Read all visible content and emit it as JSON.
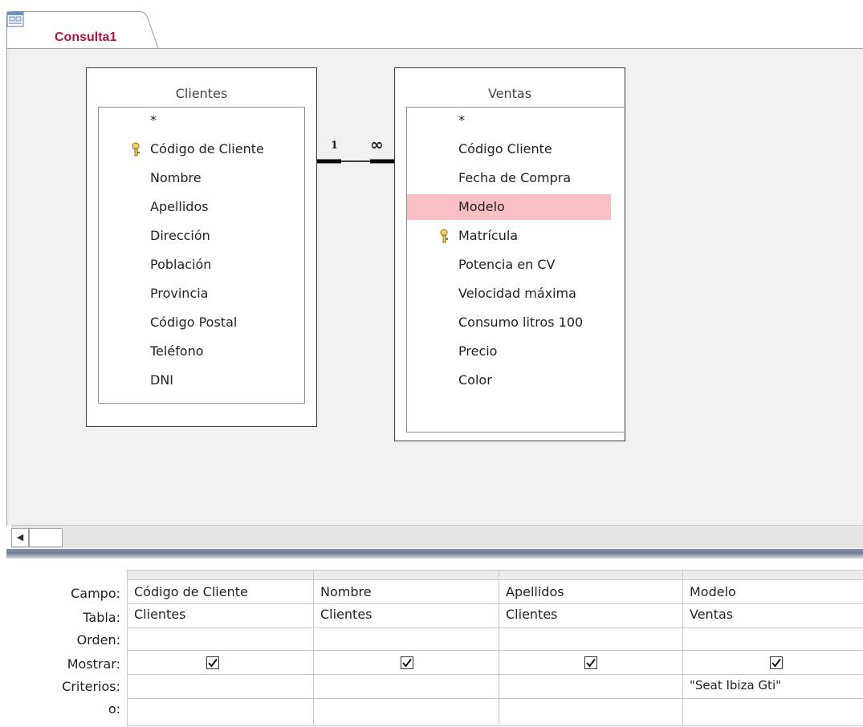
{
  "tab": {
    "label": "Consulta1",
    "icon": "query-design-icon"
  },
  "relationship": {
    "one_label": "1",
    "many_label": "∞"
  },
  "tables": [
    {
      "title": "Clientes",
      "fields": [
        {
          "name": "*",
          "key": false,
          "selected": false
        },
        {
          "name": "Código de Cliente",
          "key": true,
          "selected": false
        },
        {
          "name": "Nombre",
          "key": false,
          "selected": false
        },
        {
          "name": "Apellidos",
          "key": false,
          "selected": false
        },
        {
          "name": "Dirección",
          "key": false,
          "selected": false
        },
        {
          "name": "Población",
          "key": false,
          "selected": false
        },
        {
          "name": "Provincia",
          "key": false,
          "selected": false
        },
        {
          "name": "Código Postal",
          "key": false,
          "selected": false
        },
        {
          "name": "Teléfono",
          "key": false,
          "selected": false
        },
        {
          "name": "DNI",
          "key": false,
          "selected": false
        }
      ]
    },
    {
      "title": "Ventas",
      "fields": [
        {
          "name": "*",
          "key": false,
          "selected": false
        },
        {
          "name": "Código Cliente",
          "key": false,
          "selected": false
        },
        {
          "name": "Fecha de Compra",
          "key": false,
          "selected": false
        },
        {
          "name": "Modelo",
          "key": false,
          "selected": true
        },
        {
          "name": "Matrícula",
          "key": true,
          "selected": false
        },
        {
          "name": "Potencia en CV",
          "key": false,
          "selected": false
        },
        {
          "name": "Velocidad máxima",
          "key": false,
          "selected": false
        },
        {
          "name": "Consumo litros 100",
          "key": false,
          "selected": false
        },
        {
          "name": "Precio",
          "key": false,
          "selected": false
        },
        {
          "name": "Color",
          "key": false,
          "selected": false
        }
      ]
    }
  ],
  "grid": {
    "row_labels": [
      "Campo:",
      "Tabla:",
      "Orden:",
      "Mostrar:",
      "Criterios:",
      "o:"
    ],
    "columns": [
      {
        "campo": "Código de Cliente",
        "tabla": "Clientes",
        "orden": "",
        "mostrar": true,
        "criterios": "",
        "o": ""
      },
      {
        "campo": "Nombre",
        "tabla": "Clientes",
        "orden": "",
        "mostrar": true,
        "criterios": "",
        "o": ""
      },
      {
        "campo": "Apellidos",
        "tabla": "Clientes",
        "orden": "",
        "mostrar": true,
        "criterios": "",
        "o": ""
      },
      {
        "campo": "Modelo",
        "tabla": "Ventas",
        "orden": "",
        "mostrar": true,
        "criterios": "\"Seat Ibiza Gti\"",
        "o": ""
      }
    ]
  },
  "colors": {
    "tab_text": "#b1173a",
    "selected_field": "#f8c0c5",
    "design_bg": "#f0f0f0"
  }
}
